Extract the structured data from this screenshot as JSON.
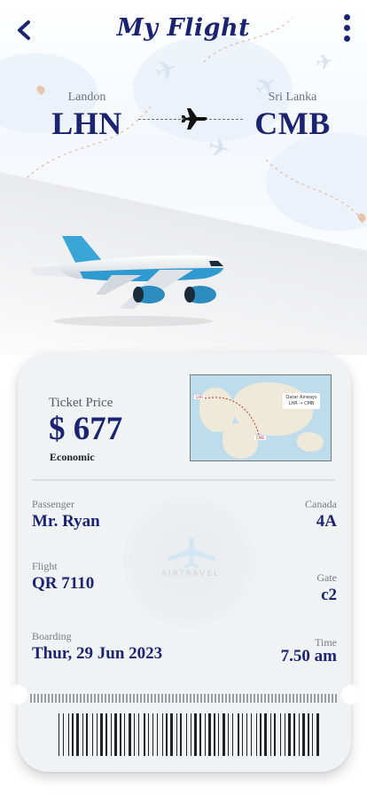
{
  "header": {
    "title": "My Flight"
  },
  "route": {
    "from": {
      "city": "Landon",
      "code": "LHN"
    },
    "to": {
      "city": "Sri Lanka",
      "code": "CMB"
    }
  },
  "ticket": {
    "price_label": "Ticket Price",
    "price": "$ 677",
    "class": "Economic",
    "map": {
      "card_title": "Qatar Airways",
      "card_route": "LHR → CMB",
      "from_tag": "LHR",
      "to_tag": "CMB"
    },
    "watermark": "AIRTRAVEL",
    "passenger_label": "Passenger",
    "passenger": "Mr. Ryan",
    "seat_label": "Canada",
    "seat": "4A",
    "flight_label": "Flight",
    "flight": "QR 7110",
    "gate_label": "Gate",
    "gate": "c2",
    "boarding_label": "Boarding",
    "boarding": "Thur, 29  Jun 2023",
    "time_label": "Time",
    "time": "7.50 am"
  },
  "colors": {
    "primary": "#1b2470",
    "ticket_bg": "#f1f2f4"
  },
  "icons": [
    "back-arrow-icon",
    "more-vertical-icon",
    "airplane-icon"
  ]
}
